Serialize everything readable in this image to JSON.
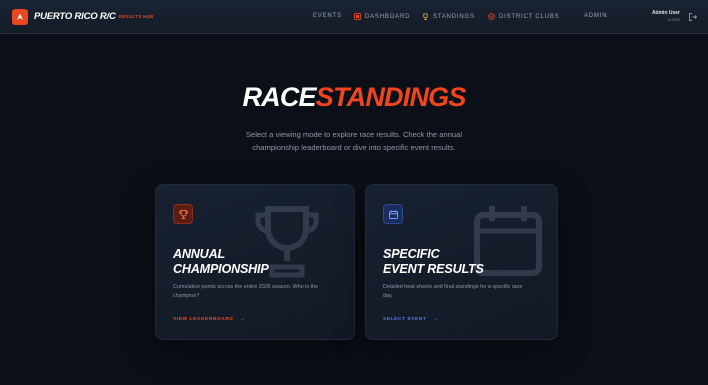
{
  "brand": {
    "name": "PUERTO RICO R/C",
    "tagline": "RESULTS HUB",
    "accent": "#e8461e"
  },
  "nav": {
    "items": [
      {
        "label": "EVENTS",
        "icon": ""
      },
      {
        "label": "DASHBOARD",
        "icon": "dashboard-icon"
      },
      {
        "label": "STANDINGS",
        "icon": "trophy-icon"
      },
      {
        "label": "DISTRICT CLUBS",
        "icon": "clubs-icon"
      },
      {
        "label": "ADMIN",
        "icon": ""
      }
    ]
  },
  "user": {
    "name": "Admin User",
    "role": "ADMIN",
    "logout_icon": "logout-icon"
  },
  "hero": {
    "title_part1": "RACE",
    "title_part2": "STANDINGS",
    "subtitle": "Select a viewing mode to explore race results. Check the annual championship leaderboard or dive into specific event results."
  },
  "cards": [
    {
      "icon": "trophy-icon",
      "title_line1": "ANNUAL",
      "title_line2": "CHAMPIONSHIP",
      "description": "Cumulative points across the entire 2026 season. Who is the champion?",
      "cta": "VIEW LEADERBOARD",
      "accent": "#ef4a22"
    },
    {
      "icon": "calendar-icon",
      "title_line1": "SPECIFIC",
      "title_line2": "EVENT RESULTS",
      "description": "Detailed heat sheets and final standings for a specific race day.",
      "cta": "SELECT EVENT",
      "accent": "#4c7fe8"
    }
  ]
}
